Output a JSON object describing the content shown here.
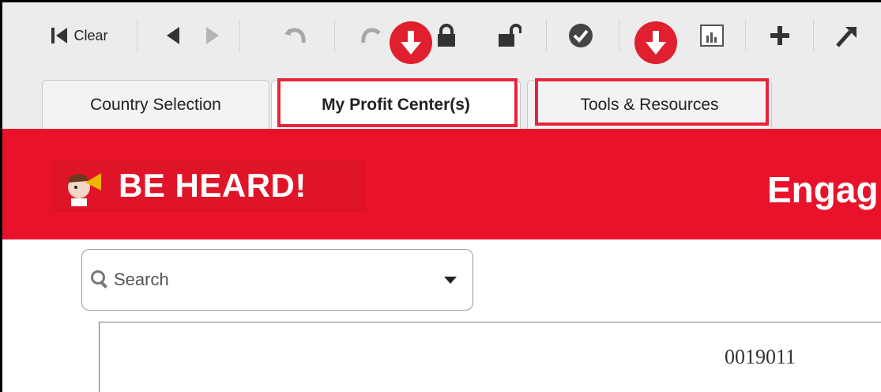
{
  "toolbar": {
    "clear_label": "Clear",
    "buttons": [
      "first-icon",
      "back-icon",
      "forward-icon",
      "undo-icon",
      "redo-icon",
      "lock-icon",
      "unlock-icon",
      "check-icon",
      "edit-icon",
      "chart-icon",
      "add-icon",
      "pin-icon"
    ]
  },
  "tabs": [
    {
      "label": "Country Selection",
      "active": false
    },
    {
      "label": "My Profit Center(s)",
      "active": true
    },
    {
      "label": "Tools & Resources",
      "active": false
    }
  ],
  "banner": {
    "logo_text": "BE HEARD!",
    "title": "Engag",
    "color": "#e8132b"
  },
  "search": {
    "placeholder": "Search"
  },
  "content": {
    "id_text": "0019011"
  },
  "annotations": {
    "highlight_color": "#e8243a",
    "arrow_color": "#e01f2f"
  }
}
